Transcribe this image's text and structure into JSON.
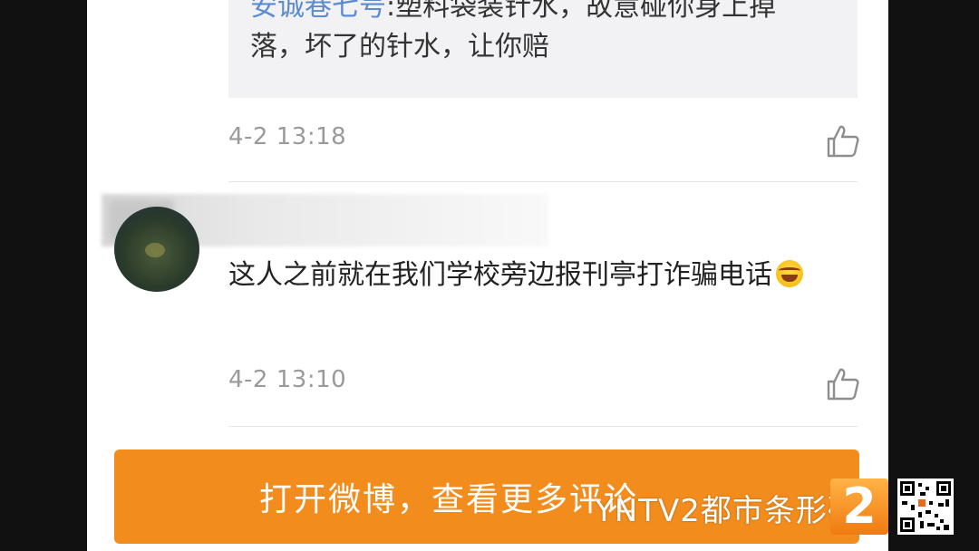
{
  "previous_comment": {
    "quoted_user": "安诚巷七号",
    "quoted_text": ":塑料袋装针水，故意碰你身上掉落，坏了的针水，让你赔",
    "timestamp": "4-2 13:18"
  },
  "comment": {
    "text": "这人之前就在我们学校旁边报刊亭打诈骗电话",
    "emoji": "laughing-with-tears-emoji",
    "timestamp": "4-2 13:10"
  },
  "open_button": {
    "label": "打开微博，查看更多评论"
  },
  "watermark": {
    "text": "YNTV2都市条形码",
    "logo_text": "2"
  },
  "colors": {
    "accent": "#f28c1c",
    "link_blue": "#5b8ccf",
    "timestamp_gray": "#9a9a9a"
  }
}
